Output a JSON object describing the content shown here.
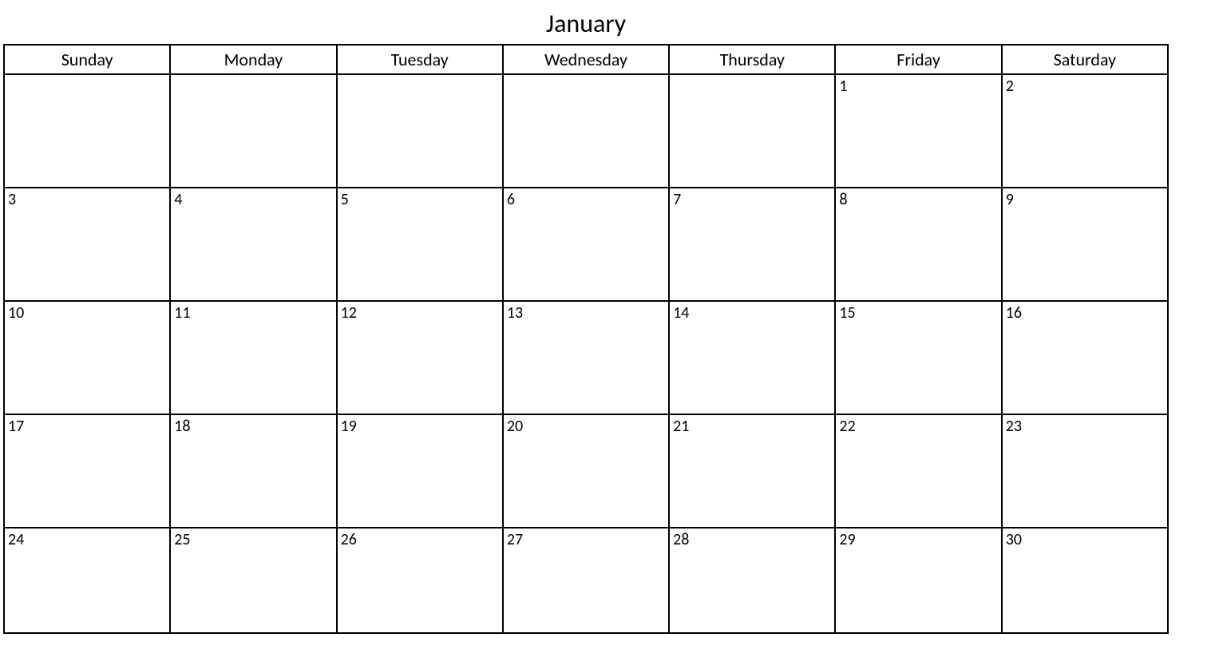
{
  "calendar": {
    "month": "January",
    "dayHeaders": [
      "Sunday",
      "Monday",
      "Tuesday",
      "Wednesday",
      "Thursday",
      "Friday",
      "Saturday"
    ],
    "weeks": [
      [
        "",
        "",
        "",
        "",
        "",
        "1",
        "2"
      ],
      [
        "3",
        "4",
        "5",
        "6",
        "7",
        "8",
        "9"
      ],
      [
        "10",
        "11",
        "12",
        "13",
        "14",
        "15",
        "16"
      ],
      [
        "17",
        "18",
        "19",
        "20",
        "21",
        "22",
        "23"
      ],
      [
        "24",
        "25",
        "26",
        "27",
        "28",
        "29",
        "30"
      ]
    ]
  }
}
